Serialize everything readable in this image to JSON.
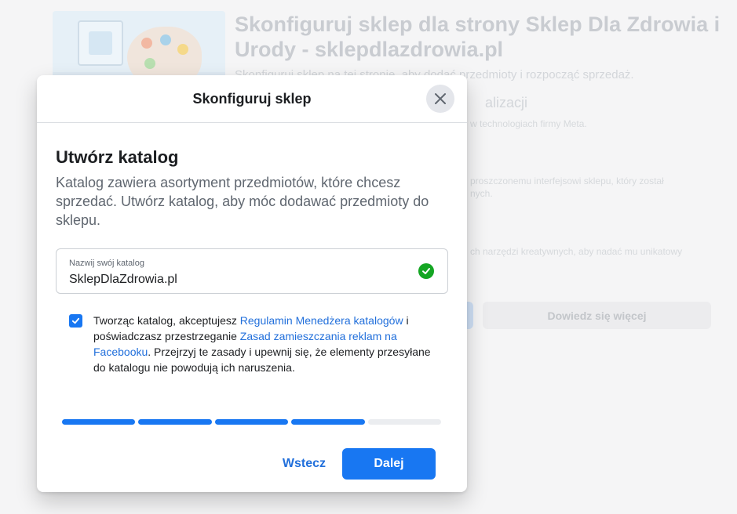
{
  "background": {
    "title": "Skonfiguruj sklep dla strony Sklep Dla Zdrowia i Urody - sklepdlazdrowia.pl",
    "subtitle": "Skonfiguruj sklep na tej stronie, aby dodać przedmioty i rozpocząć sprzedaż.",
    "feature_title_fragment": "alizacji",
    "text_1": "w technologiach firmy Meta.",
    "text_2a": "proszczonemu interfejsowi sklepu, który został",
    "text_2b": "nych.",
    "text_3": "ch narzędzi kreatywnych, aby nadać mu unikatowy",
    "learn_more_label": "Dowiedz się więcej"
  },
  "modal": {
    "title": "Skonfiguruj sklep",
    "section_title": "Utwórz katalog",
    "section_description": "Katalog zawiera asortyment przedmiotów, które chcesz sprzedać. Utwórz katalog, aby móc dodawać przedmioty do sklepu.",
    "catalog_field": {
      "label": "Nazwij swój katalog",
      "value": "SklepDlaZdrowia.pl"
    },
    "terms": {
      "checked": true,
      "text_1": "Tworząc katalog, akceptujesz ",
      "link_1": "Regulamin Menedżera katalogów",
      "text_2": " i poświadczasz przestrzeganie ",
      "link_2": "Zasad zamieszczania reklam na Facebooku",
      "text_3": ". Przejrzyj te zasady i upewnij się, że elementy przesyłane do katalogu nie powodują ich naruszenia."
    },
    "progress": {
      "total_steps": 5,
      "completed_steps": 4
    },
    "back_label": "Wstecz",
    "next_label": "Dalej"
  },
  "colors": {
    "primary": "#1877f2",
    "link": "#216fdb",
    "success": "#14a623",
    "progress_track": "#ebedf0"
  },
  "icons": {
    "close": "close-icon",
    "valid": "check-circle-icon",
    "checkbox": "checkbox-checked-icon"
  }
}
